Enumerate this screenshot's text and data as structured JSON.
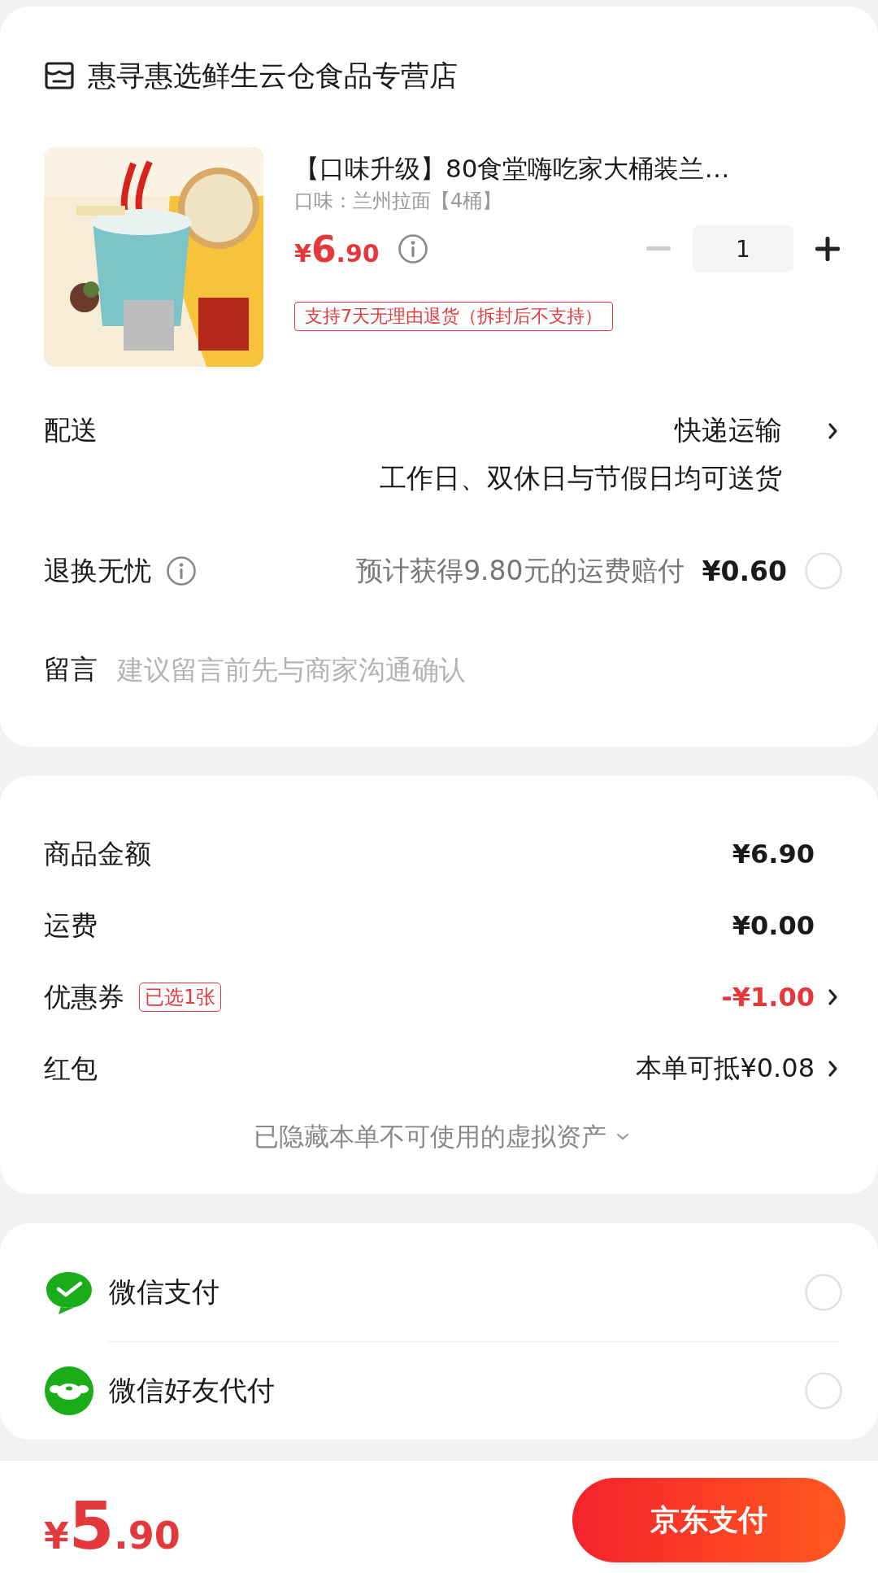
{
  "store": {
    "name": "惠寻惠选鲜生云仓食品专营店"
  },
  "product": {
    "title": "【口味升级】80食堂嗨吃家大桶装兰…",
    "variant": "口味：兰州拉面【4桶】",
    "price": {
      "symbol": "¥",
      "integer": "6",
      "decimal": ".90"
    },
    "quantity": "1",
    "decrease_disabled": true,
    "return_policy": "支持7天无理由退货（拆封后不支持）"
  },
  "delivery": {
    "label": "配送",
    "method": "快递运输",
    "schedule": "工作日、双休日与节假日均可送货"
  },
  "return_insurance": {
    "label": "退换无忧",
    "description": "预计获得9.80元的运费赔付",
    "price": "¥0.60",
    "selected": false
  },
  "message": {
    "label": "留言",
    "placeholder": "建议留言前先与商家沟通确认"
  },
  "summary": {
    "rows": [
      {
        "kind": "amount",
        "label": "商品金额",
        "value": "¥6.90"
      },
      {
        "kind": "amount",
        "label": "运费",
        "value": "¥0.00"
      },
      {
        "kind": "discount",
        "label": "优惠券",
        "tag": "已选1张",
        "value": "-¥1.00"
      },
      {
        "kind": "link",
        "label": "红包",
        "value": "本单可抵¥0.08"
      }
    ],
    "hidden_note": "已隐藏本单不可使用的虚拟资产"
  },
  "payment_methods": [
    {
      "kind": "wechat",
      "name": "微信支付",
      "selected": false
    },
    {
      "kind": "friend",
      "name": "微信好友代付",
      "selected": false
    }
  ],
  "footer": {
    "price": {
      "symbol": "¥",
      "integer": "5",
      "decimal": ".90"
    },
    "pay_button": "京东支付"
  }
}
